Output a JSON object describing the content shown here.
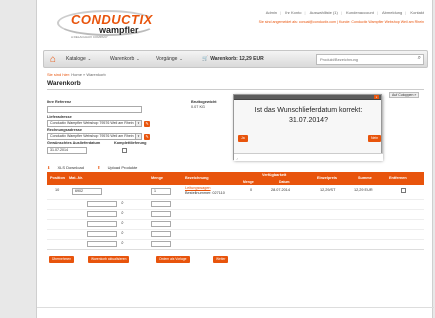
{
  "brand": {
    "logo_main": "CONDUCTIX",
    "logo_sub": "wampfler",
    "logo_tag": "A DELACHAUX COMPANY"
  },
  "toplinks": [
    "Admin",
    "Ihr Konto",
    "Auswahlliste (1)",
    "Kundenaccount",
    "Abmeldung",
    "Kontakt"
  ],
  "userline": "Sie sind angemeldet als: conual@conductix.com  |  Kunde: Conductix Wampfler Webshop  Weil am Rhein",
  "nav": {
    "home_icon": "home-icon",
    "items": [
      "Kataloge",
      "Warenkorb",
      "Vorgänge"
    ],
    "cart_label": "Warenkorb: 12,29 EUR",
    "search_placeholder": "Produkt/Bezeichnung"
  },
  "breadcrumb": {
    "prefix": "Sie sind hier:",
    "path": "Home » Warenkorb"
  },
  "page_title": "Warenkorb",
  "form": {
    "ihre_referenz_label": "Ihre Referenz",
    "ihre_referenz_value": "",
    "lieferadresse_label": "Lieferadresse",
    "lieferadresse_value": "Conductix Wampfler Webshop 79576 Weil am Rhein",
    "rechnungsadresse_label": "Rechnungsadresse",
    "rechnungsadresse_value": "Conductix Wampfler Webshop 79576 Weil am Rhein",
    "auslieferdatum_label": "Gewünschtes Auslieferdatum",
    "auslieferdatum_value": "31.07.2014",
    "komplettlieferung_label": "Komplettlieferung",
    "bruttogewicht_label": "Bruttogewicht",
    "bruttogewicht_value": "0.07 KG"
  },
  "dialog": {
    "question": "Ist das Wunschlieferdatum korrekt:",
    "date": "31.07.2014?",
    "yes_label": "Ja",
    "no_label": "Nein",
    "close": "x"
  },
  "auf_button": "Auf Cutoppen",
  "tools": {
    "xls_label": "XLS Download",
    "upload_label": "Upload Produkte"
  },
  "table": {
    "headers": {
      "position": "Position",
      "mat_nr": "Mat.-Nr.",
      "menge": "Menge",
      "bezeichnung": "Bezeichnung",
      "verfuegbarkeit": "Verfügbarkeit",
      "verf_menge": "Menge",
      "verf_datum": "Datum",
      "einzelpreis": "Einzelpreis",
      "summe": "Summe",
      "entfernen": "Entfernen"
    },
    "rows": [
      {
        "position": "10",
        "mat_nr": "6902",
        "menge": "1",
        "bez_line1": "Leitungswagen",
        "bez_line2": "Bestellnummer: 027110",
        "verf_menge": "0",
        "verf_datum": "28.07.2014",
        "einzelpreis": "12,29/ST",
        "summe": "12,29 EUR"
      }
    ]
  },
  "actions": [
    "Übernehmen",
    "Warenkorb aktualisieren",
    "Ordern als Vorlage",
    "Weiter"
  ],
  "colors": {
    "accent": "#e8540c",
    "nav_bg": "#e4e4e4"
  }
}
